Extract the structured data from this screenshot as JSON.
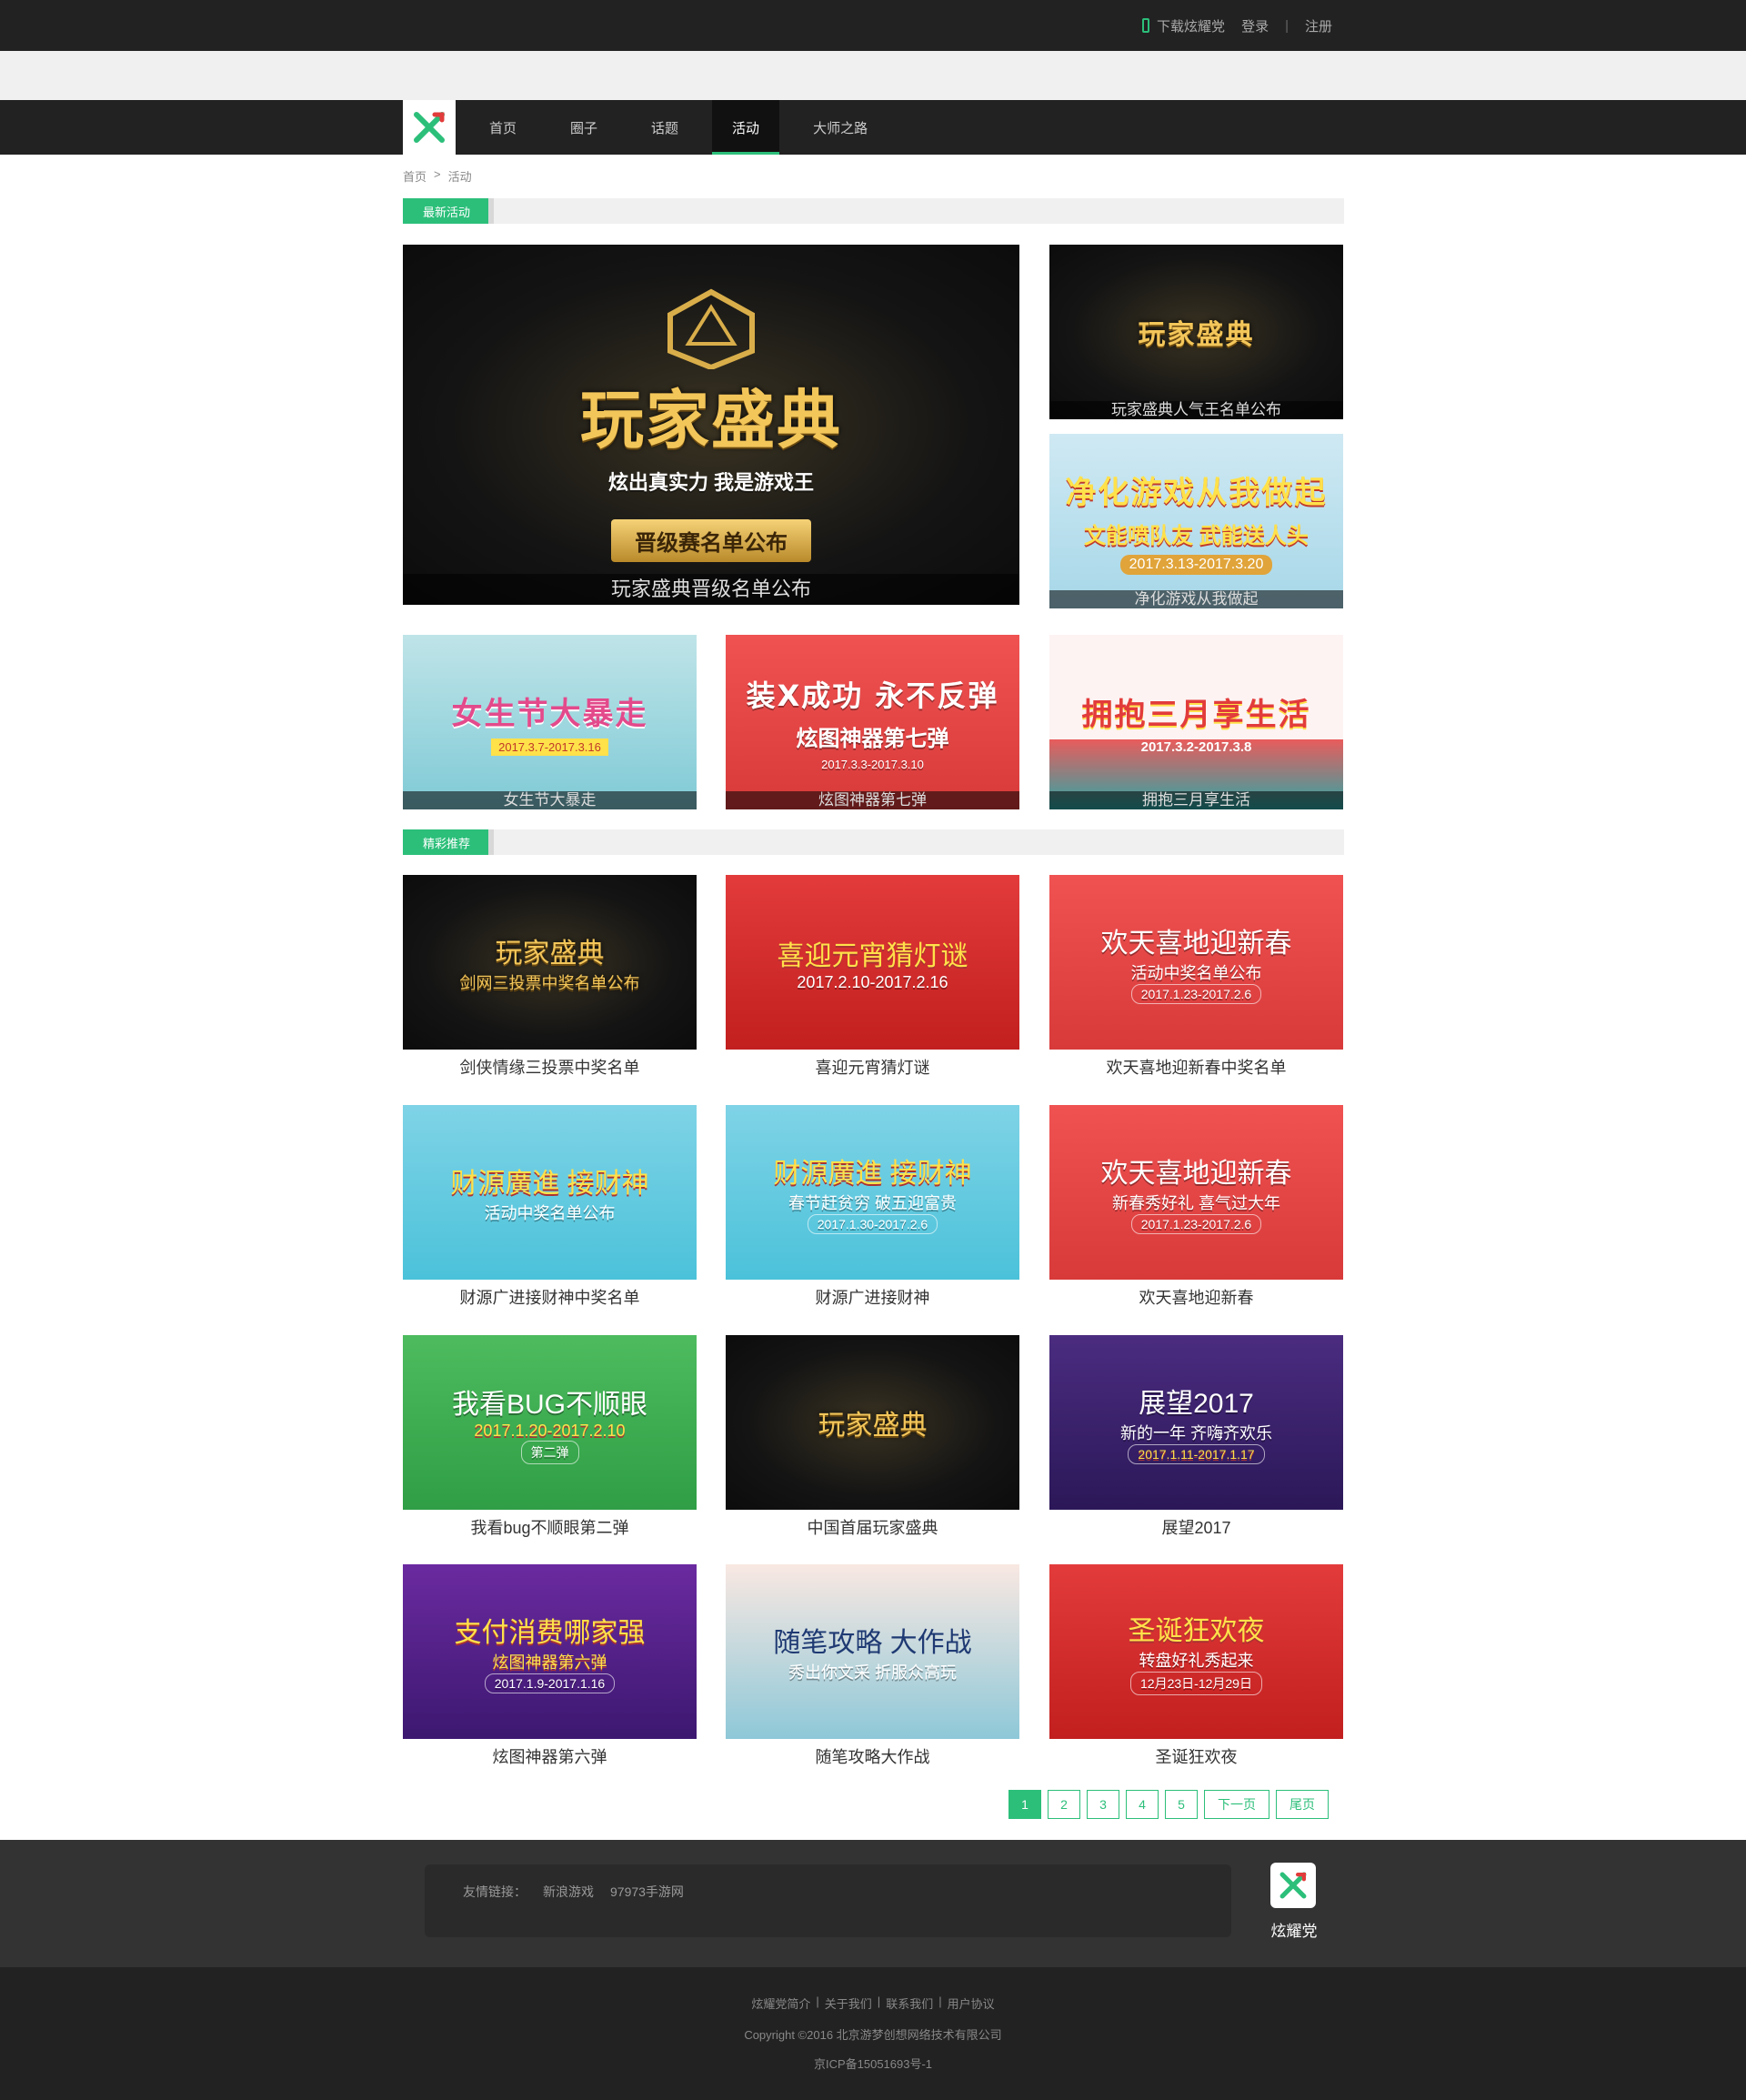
{
  "topbar": {
    "download": "下载炫耀党",
    "login": "登录",
    "separator": "|",
    "register": "注册"
  },
  "nav": {
    "items": [
      "首页",
      "圈子",
      "话题",
      "活动",
      "大师之路"
    ],
    "active": "活动"
  },
  "breadcrumb": {
    "home": "首页",
    "arrow": ">",
    "current": "活动"
  },
  "sections": {
    "latest": "最新活动",
    "featured": "精彩推荐"
  },
  "latest": {
    "big": {
      "caption": "玩家盛典晋级名单公布",
      "art_title": "玩家盛典",
      "art_sub": "炫出真实力   我是游戏王",
      "art_ribbon": "晋级赛名单公布"
    },
    "side": [
      {
        "caption": "玩家盛典人气王名单公布",
        "art_title": "玩家盛典"
      },
      {
        "caption": "净化游戏从我做起",
        "art_title": "净化游戏从我做起",
        "art_sub": "文能喷队友 武能送人头",
        "art_date": "2017.3.13-2017.3.20"
      }
    ],
    "row": [
      {
        "caption": "女生节大暴走",
        "art_title": "女生节大暴走",
        "art_date": "2017.3.7-2017.3.16"
      },
      {
        "caption": "炫图神器第七弹",
        "art_title": "装X成功 永不反弹",
        "art_sub": "炫图神器第七弹",
        "art_date": "2017.3.3-2017.3.10"
      },
      {
        "caption": "拥抱三月享生活",
        "art_title": "拥抱三月享生活",
        "art_date": "2017.3.2-2017.3.8"
      }
    ]
  },
  "featured": [
    {
      "label": "剑侠情缘三投票中奖名单",
      "art_title": "玩家盛典",
      "art_sub": "剑网三投票中奖名单公布",
      "bg": "gold"
    },
    {
      "label": "喜迎元宵猜灯谜",
      "art_title": "喜迎元宵猜灯谜",
      "art_sub": "2017.2.10-2017.2.16",
      "bg": "redcn"
    },
    {
      "label": "欢天喜地迎新春中奖名单",
      "art_title": "欢天喜地迎新春",
      "art_sub": "活动中奖名单公布",
      "art_date": "2017.1.23-2017.2.6",
      "bg": "red"
    },
    {
      "label": "财源广进接财神中奖名单",
      "art_title": "财源廣進 接财神",
      "art_sub": "活动中奖名单公布",
      "bg": "cyan"
    },
    {
      "label": "财源广进接财神",
      "art_title": "财源廣進 接财神",
      "art_sub": "春节赶贫穷 破五迎富贵",
      "art_date": "2017.1.30-2017.2.6",
      "bg": "cyan"
    },
    {
      "label": "欢天喜地迎新春",
      "art_title": "欢天喜地迎新春",
      "art_sub": "新春秀好礼 喜气过大年",
      "art_date": "2017.1.23-2017.2.6",
      "bg": "red"
    },
    {
      "label": "我看bug不顺眼第二弹",
      "art_title": "我看BUG不顺眼",
      "art_sub": "2017.1.20-2017.2.10",
      "art_date": "第二弹",
      "bg": "green"
    },
    {
      "label": "中国首届玩家盛典",
      "art_title": "玩家盛典",
      "bg": "gold"
    },
    {
      "label": "展望2017",
      "art_title": "展望2017",
      "art_sub": "新的一年 齐嗨齐欢乐",
      "art_date": "2017.1.11-2017.1.17",
      "bg": "purple"
    },
    {
      "label": "炫图神器第六弹",
      "art_title": "支付消费哪家强",
      "art_sub": "炫图神器第六弹",
      "art_date": "2017.1.9-2017.1.16",
      "bg": "purple2"
    },
    {
      "label": "随笔攻略大作战",
      "art_title": "随笔攻略 大作战",
      "art_sub": "秀出你文采 折服众高玩",
      "bg": "pale"
    },
    {
      "label": "圣诞狂欢夜",
      "art_title": "圣诞狂欢夜",
      "art_sub": "转盘好礼秀起来",
      "art_date": "12月23日-12月29日",
      "bg": "redcn"
    }
  ],
  "pagination": {
    "pages": [
      "1",
      "2",
      "3",
      "4",
      "5"
    ],
    "next": "下一页",
    "last": "尾页",
    "current": "1"
  },
  "footer": {
    "friend_label": "友情链接：",
    "friends": [
      "新浪游戏",
      "97973手游网"
    ],
    "brand": "炫耀党",
    "links": [
      "炫耀党简介",
      "关于我们",
      "联系我们",
      "用户协议"
    ],
    "link_sep": "|",
    "copyright": "Copyright ©2016 北京游梦创想网络技术有限公司",
    "icp": "京ICP备15051693号-1"
  },
  "colors": {
    "accent": "#2cbf7a",
    "topbar": "#222222",
    "footer": "#333333"
  }
}
